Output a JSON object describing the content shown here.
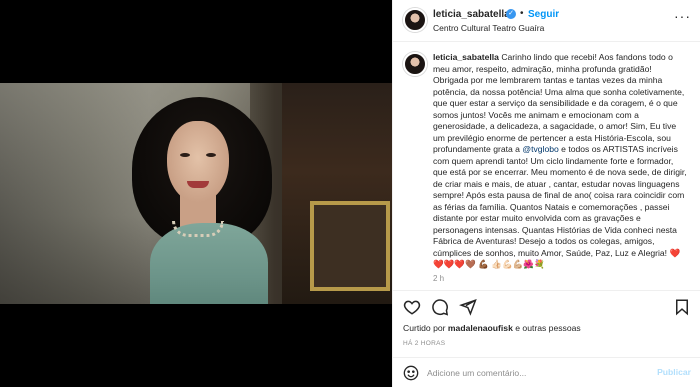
{
  "post": {
    "username": "leticia_sabatella",
    "verified_mark": "✓",
    "separator": "•",
    "follow_label": "Seguir",
    "location": "Centro Cultural Teatro Guaíra",
    "more_label": "···"
  },
  "caption": {
    "username": "leticia_sabatella",
    "part1": " Carinho lindo que recebi! Aos fandons todo o meu amor, respeito, admiração, minha profunda gratidão! Obrigada por me lembrarem tantas e tantas vezes da minha potência, da nossa potência! Uma alma que sonha coletivamente, que quer estar a serviço da sensibilidade e da coragem, é o que somos juntos! Vocês me animam e emocionam com a generosidade, a delicadeza, a sagacidade, o amor! Sim, Eu tive um previlégio enorme de pertencer a esta História-Escola, sou profundamente grata a ",
    "mention": "@tvglobo",
    "part2": " e todos os ARTISTAS incríveis com quem aprendi tanto! Um ciclo lindamente forte e formador, que está por se encerrar. Meu momento é de nova sede, de dirigir, de criar mais e mais, de atuar , cantar, estudar novas linguagens sempre! Após esta pausa de final de ano( coisa rara coincidir com as férias da família. Quantos Natais e comemorações , passei distante por estar muito envolvida com as gravações e personagens intensas. Quantas Histórias de Vida conheci nesta Fábrica de Aventuras! Desejo a todos os colegas, amigos, cúmplices de sonhos, muito Amor, Saúde, Paz, Luz e Alegria! ❤️❤️❤️❤️🤎 💪🏾 👍🏻💪🏻💪🏼🌺💐",
    "time_ago": "2 h"
  },
  "engagement": {
    "likes_prefix": "Curtido por ",
    "likes_user": "madalenaoufisk",
    "likes_suffix": " e outras pessoas",
    "posted_ago": "HÁ 2 HORAS"
  },
  "comment": {
    "placeholder": "Adicione um comentário...",
    "publish_label": "Publicar"
  },
  "icons": {
    "like": "heart-icon",
    "comment": "comment-icon",
    "share": "paper-plane-icon",
    "save": "bookmark-icon",
    "emoji": "smiley-icon"
  },
  "colors": {
    "accent": "#0095f6",
    "verified": "#3897f0",
    "publish_disabled": "#b2dffc"
  }
}
